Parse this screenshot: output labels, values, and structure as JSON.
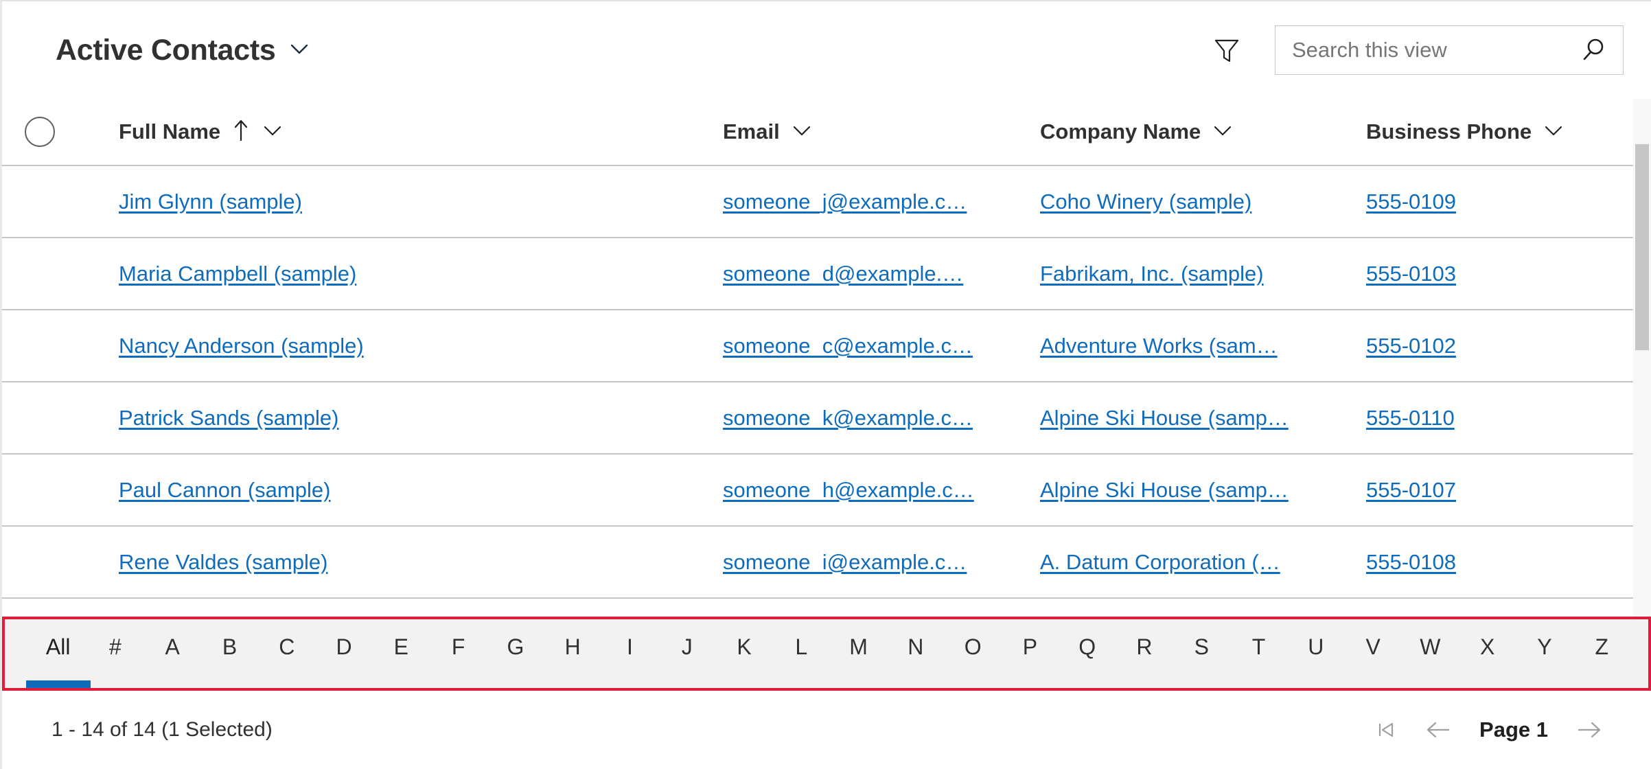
{
  "header": {
    "view_title": "Active Contacts",
    "view_chevron_icon": "chevron-down-icon",
    "filter_icon": "filter-funnel-icon",
    "search_placeholder": "Search this view",
    "search_value": "",
    "search_icon": "search-magnifier-icon"
  },
  "grid": {
    "select_all_icon": "select-all-circle-icon",
    "columns": [
      {
        "label": "Full Name",
        "sort": "ascending",
        "sort_icon": "arrow-up-icon",
        "menu_icon": "chevron-down-icon"
      },
      {
        "label": "Email",
        "sort": "none",
        "menu_icon": "chevron-down-icon"
      },
      {
        "label": "Company Name",
        "sort": "none",
        "menu_icon": "chevron-down-icon"
      },
      {
        "label": "Business Phone",
        "sort": "none",
        "menu_icon": "chevron-down-icon"
      }
    ],
    "rows": [
      {
        "full_name": "Jim Glynn (sample)",
        "email": "someone_j@example.c…",
        "company": "Coho Winery (sample)",
        "phone": "555-0109"
      },
      {
        "full_name": "Maria Campbell (sample)",
        "email": "someone_d@example.…",
        "company": "Fabrikam, Inc. (sample)",
        "phone": "555-0103"
      },
      {
        "full_name": "Nancy Anderson (sample)",
        "email": "someone_c@example.c…",
        "company": "Adventure Works (sam…",
        "phone": "555-0102"
      },
      {
        "full_name": "Patrick Sands (sample)",
        "email": "someone_k@example.c…",
        "company": "Alpine Ski House (samp…",
        "phone": "555-0110"
      },
      {
        "full_name": "Paul Cannon (sample)",
        "email": "someone_h@example.c…",
        "company": "Alpine Ski House (samp…",
        "phone": "555-0107"
      },
      {
        "full_name": "Rene Valdes (sample)",
        "email": "someone_i@example.c…",
        "company": "A. Datum Corporation (…",
        "phone": "555-0108"
      }
    ]
  },
  "alpha_filter": {
    "selected": "All",
    "highlight_color": "#e01b3c",
    "indicator_color": "#0f6cbd",
    "background": "#f3f2f1",
    "items": [
      "All",
      "#",
      "A",
      "B",
      "C",
      "D",
      "E",
      "F",
      "G",
      "H",
      "I",
      "J",
      "K",
      "L",
      "M",
      "N",
      "O",
      "P",
      "Q",
      "R",
      "S",
      "T",
      "U",
      "V",
      "W",
      "X",
      "Y",
      "Z"
    ]
  },
  "footer": {
    "record_count": "1 - 14 of 14 (1 Selected)",
    "page_label": "Page 1",
    "first_page_icon": "page-first-icon",
    "prev_page_icon": "arrow-left-icon",
    "next_page_icon": "arrow-right-icon"
  },
  "colors": {
    "link": "#0f6cbd",
    "text": "#323130",
    "border": "#c8c6c4",
    "accent_red": "#e01b3c"
  }
}
